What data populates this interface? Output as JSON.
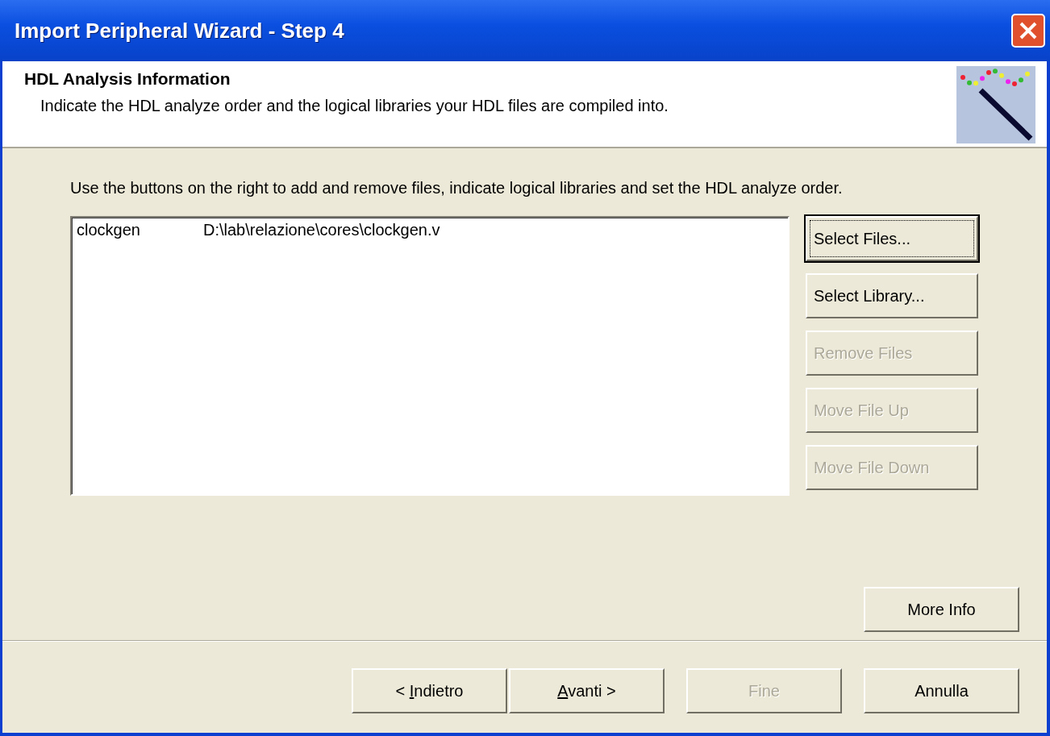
{
  "window": {
    "title": "Import Peripheral Wizard - Step 4"
  },
  "header": {
    "title": "HDL Analysis Information",
    "subtitle": "Indicate the HDL analyze order and the logical libraries your HDL files are compiled into."
  },
  "instructions": "Use the buttons on the right to add and remove files, indicate logical libraries and set the HDL analyze order.",
  "files": [
    {
      "library": "clockgen",
      "path": "D:\\lab\\relazione\\cores\\clockgen.v"
    }
  ],
  "side_buttons": [
    {
      "label": "Select Files...",
      "disabled": false,
      "focused": true
    },
    {
      "label": "Select Library...",
      "disabled": false,
      "focused": false
    },
    {
      "label": "Remove Files",
      "disabled": true,
      "focused": false
    },
    {
      "label": "Move File Up",
      "disabled": true,
      "focused": false
    },
    {
      "label": "Move File Down",
      "disabled": true,
      "focused": false
    }
  ],
  "more_info": {
    "label": "More Info"
  },
  "nav_buttons": [
    {
      "label_parts": [
        {
          "text": "< ",
          "underlined": false
        },
        {
          "text": "I",
          "underlined": true
        },
        {
          "text": "ndietro",
          "underlined": false
        }
      ],
      "disabled": false
    },
    {
      "label_parts": [
        {
          "text": "A",
          "underlined": true
        },
        {
          "text": "vanti >",
          "underlined": false
        }
      ],
      "disabled": false
    },
    {
      "label_parts": [
        {
          "text": "Fine",
          "underlined": false
        }
      ],
      "disabled": true
    },
    {
      "label_parts": [
        {
          "text": "Annulla",
          "underlined": false
        }
      ],
      "disabled": false
    }
  ]
}
